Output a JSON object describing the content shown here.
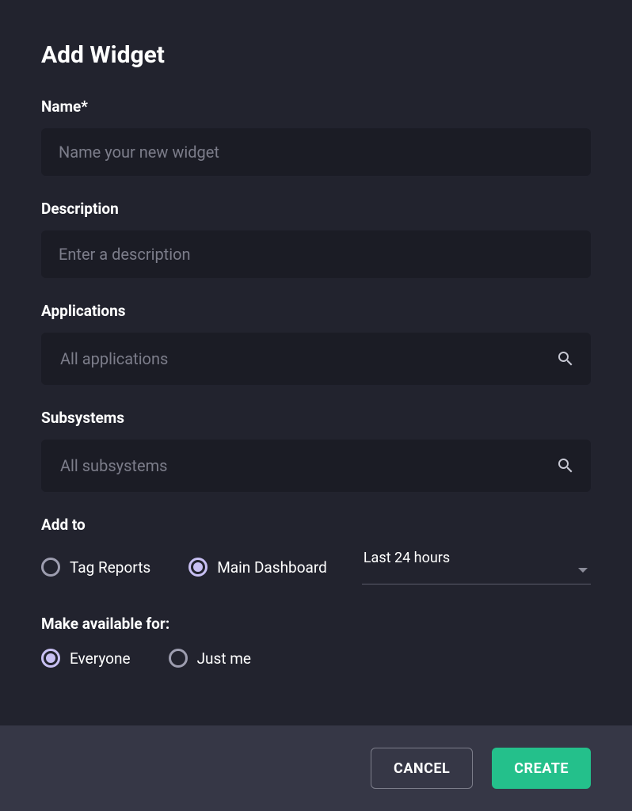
{
  "dialog": {
    "title": "Add Widget"
  },
  "fields": {
    "name": {
      "label": "Name*",
      "placeholder": "Name your new widget",
      "value": ""
    },
    "description": {
      "label": "Description",
      "placeholder": "Enter a description",
      "value": ""
    },
    "applications": {
      "label": "Applications",
      "placeholder": "All applications",
      "value": ""
    },
    "subsystems": {
      "label": "Subsystems",
      "placeholder": "All subsystems",
      "value": ""
    }
  },
  "addTo": {
    "label": "Add to",
    "options": {
      "tagReports": "Tag Reports",
      "mainDashboard": "Main Dashboard"
    },
    "selected": "mainDashboard",
    "timeframe": {
      "selected": "Last 24 hours"
    }
  },
  "availability": {
    "label": "Make available for:",
    "options": {
      "everyone": "Everyone",
      "justMe": "Just me"
    },
    "selected": "everyone"
  },
  "footer": {
    "cancel": "CANCEL",
    "create": "CREATE"
  }
}
